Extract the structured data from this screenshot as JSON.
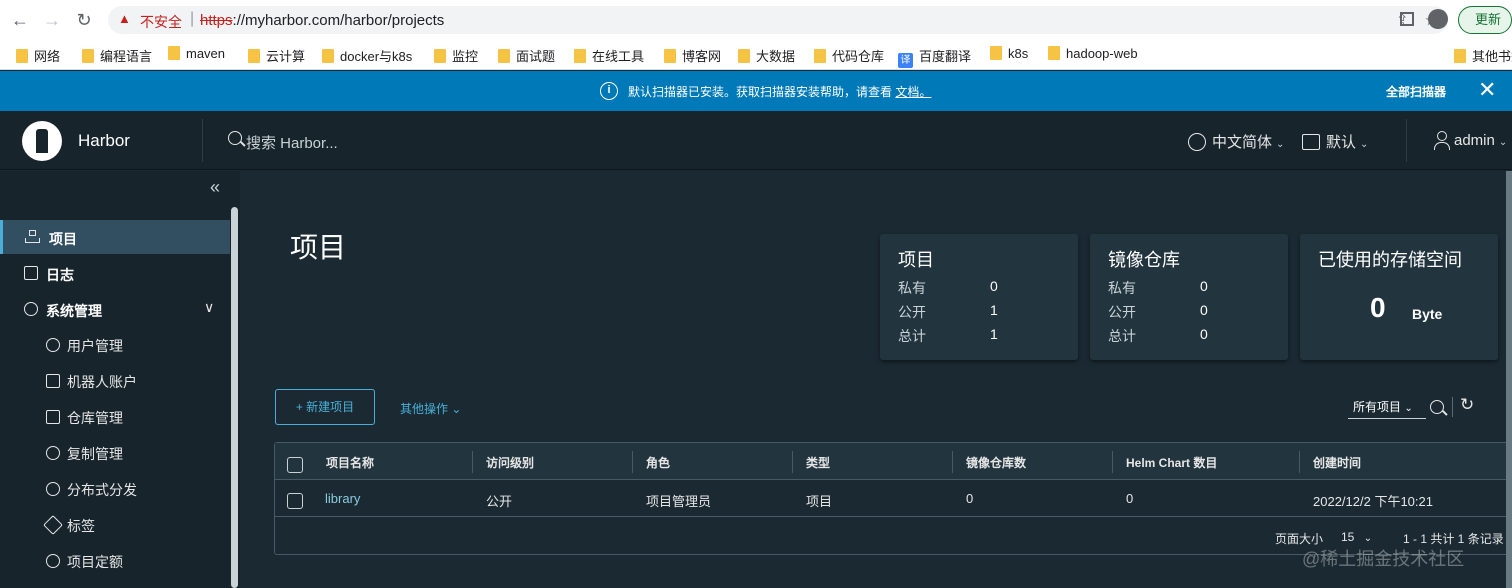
{
  "browser": {
    "insecure_label": "不安全",
    "url_proto": "https",
    "url_rest": "://myharbor.com/harbor/projects",
    "update_label": "更新",
    "bookmarks": [
      "网络",
      "编程语言",
      "maven",
      "云计算",
      "docker与k8s",
      "监控",
      "面试题",
      "在线工具",
      "博客网",
      "大数据",
      "代码仓库",
      "百度翻译",
      "k8s",
      "hadoop-web",
      "其他书签"
    ]
  },
  "banner": {
    "text": "默认扫描器已安装。获取扫描器安装帮助，请查看",
    "link": "文档。",
    "action": "全部扫描器"
  },
  "header": {
    "brand": "Harbor",
    "search_placeholder": "搜索 Harbor...",
    "language": "中文简体",
    "date_format": "默认",
    "user": "admin"
  },
  "sidebar": {
    "items": [
      {
        "label": "项目"
      },
      {
        "label": "日志"
      },
      {
        "label": "系统管理"
      }
    ],
    "sub_items": [
      {
        "label": "用户管理"
      },
      {
        "label": "机器人账户"
      },
      {
        "label": "仓库管理"
      },
      {
        "label": "复制管理"
      },
      {
        "label": "分布式分发"
      },
      {
        "label": "标签"
      },
      {
        "label": "项目定额"
      }
    ]
  },
  "main": {
    "title": "项目",
    "cards": {
      "projects": {
        "title": "项目",
        "private_label": "私有",
        "private": "0",
        "public_label": "公开",
        "public": "1",
        "total_label": "总计",
        "total": "1"
      },
      "repos": {
        "title": "镜像仓库",
        "private_label": "私有",
        "private": "0",
        "public_label": "公开",
        "public": "0",
        "total_label": "总计",
        "total": "0"
      },
      "storage": {
        "title": "已使用的存储空间",
        "value": "0",
        "unit": "Byte"
      }
    },
    "new_project": "+ 新建项目",
    "other_ops": "其他操作",
    "filter": "所有项目",
    "table": {
      "headers": [
        "项目名称",
        "访问级别",
        "角色",
        "类型",
        "镜像仓库数",
        "Helm Chart 数目",
        "创建时间"
      ],
      "rows": [
        {
          "name": "library",
          "access": "公开",
          "role": "项目管理员",
          "type": "项目",
          "repos": "0",
          "charts": "0",
          "created": "2022/12/2 下午10:21"
        }
      ],
      "page_size_label": "页面大小",
      "page_size": "15",
      "page_info": "1 - 1 共计 1 条记录"
    }
  },
  "watermark": "@稀土掘金技术社区"
}
